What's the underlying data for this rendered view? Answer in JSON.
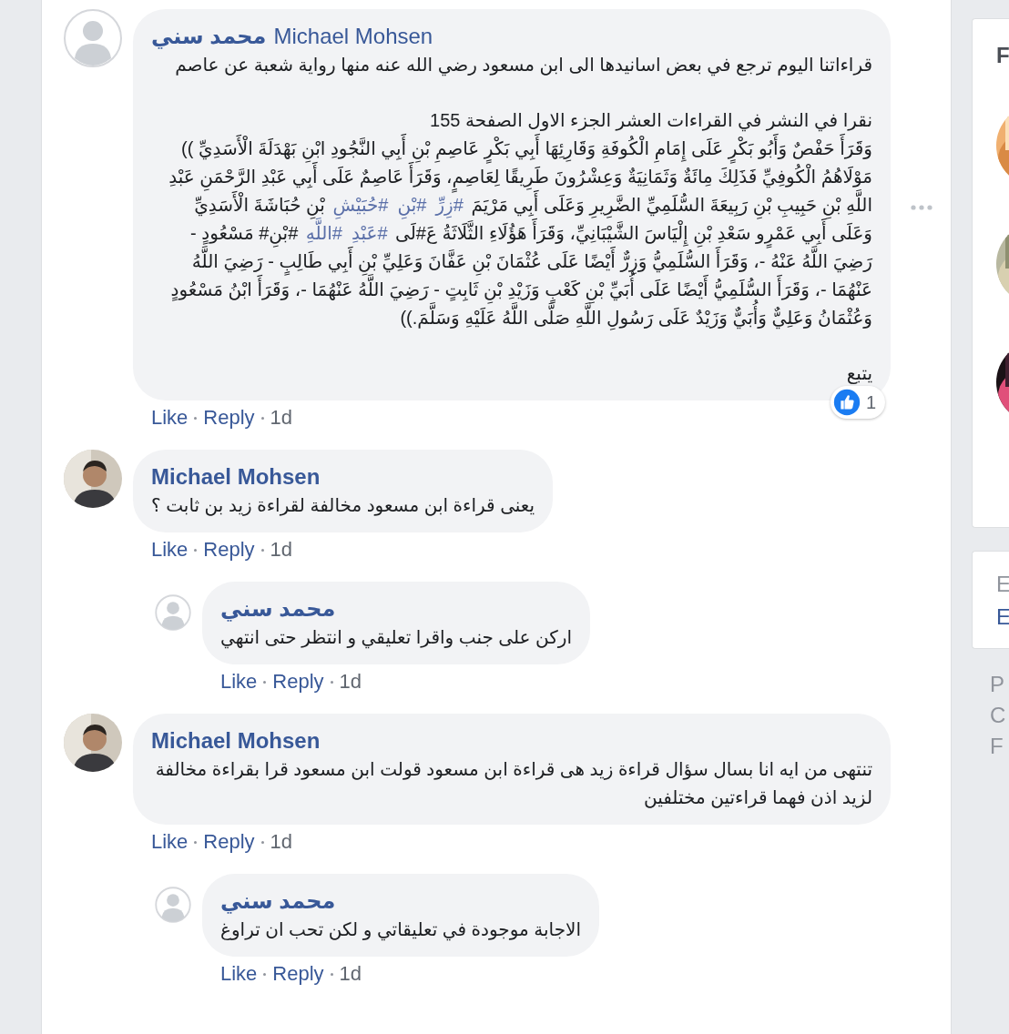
{
  "comments": [
    {
      "author": "محمد سني",
      "mention": "Michael Mohsen",
      "kind": "default",
      "paragraphs": [
        [
          {
            "kind": "text",
            "text": "قراءاتنا اليوم ترجع في بعض اسانيدها الى ابن مسعود رضي الله عنه منها رواية شعبة عن عاصم"
          }
        ],
        [
          {
            "kind": "text",
            "text": "نقرا في النشر في القراءات العشر الجزء الاول الصفحة 155"
          },
          {
            "kind": "break"
          },
          {
            "kind": "text",
            "text": "وَقَرَأَ حَفْصٌ وَأَبُو بَكْرٍ عَلَى إِمَامِ الْكُوفَةِ وَقَارِئِهَا أَبِي بَكْرٍ عَاصِمِ بْنِ أَبِي النَّجُودِ ابْنِ بَهْدَلَةَ الْأَسَدِيِّ )) مَوْلَاهُمُ الْكُوفِيِّ فَذَلِكَ مِائَةٌ وَثَمَانِيَةٌ وَعِشْرُونَ طَرِيقًا لِعَاصِمٍ، وَقَرَأَ عَاصِمٌ عَلَى أَبِي عَبْدِ الرَّحْمَنِ عَبْدِ اللَّهِ بْنِ حَبِيبِ بْنِ رَبِيعَةَ السُّلَمِيِّ الضَّرِيرِ وَعَلَى أَبِي مَرْيَمَ "
          },
          {
            "kind": "hashtag",
            "text": "#زِرِّ"
          },
          {
            "kind": "hashtag",
            "text": "#بْنِ"
          },
          {
            "kind": "hashtag",
            "text": "#حُبَيْشِ"
          },
          {
            "kind": "text",
            "text": " بْنِ حُبَاشَةَ الْأَسَدِيِّ وَعَلَى أَبِي عَمْرٍو سَعْدِ بْنِ إِلْيَاسَ الشَّيْبَانِيِّ، وَقَرَأَ هَؤُلَاءِ الثَّلَاثَةُ عَ#لَى "
          },
          {
            "kind": "hashtag",
            "text": "#عَبْدِ"
          },
          {
            "kind": "hashtag",
            "text": "#اللَّهِ"
          },
          {
            "kind": "text",
            "text": " #بْنِ# مَسْعُودٍ - رَضِيَ اللَّهُ عَنْهُ -، وَقَرَأَ السُّلَمِيُّ وَزِرٌّ أَيْضًا عَلَى عُثْمَانَ بْنِ عَفَّانَ وَعَلِيِّ بْنِ أَبِي طَالِبٍ - رَضِيَ اللَّهُ عَنْهُمَا -، وَقَرَأَ السُّلَمِيُّ أَيْضًا عَلَى أُبَيِّ بْنِ كَعْبٍ وَزَيْدِ بْنِ ثَابِتٍ - رَضِيَ اللَّهُ عَنْهُمَا -، وَقَرَأَ ابْنُ مَسْعُودٍ وَعُثْمَانُ وَعَلِيٌّ وَأُبَيٌّ وَزَيْدٌ عَلَى رَسُولِ اللَّهِ صَلَّى اللَّهُ عَلَيْهِ وَسَلَّمَ.))"
          }
        ],
        [
          {
            "kind": "text",
            "text": "يتبع"
          }
        ]
      ],
      "like": "Like",
      "reply": "Reply",
      "time": "1d",
      "reaction_count": "1"
    },
    {
      "author": "Michael Mohsen",
      "paragraphs": [
        [
          {
            "kind": "text",
            "text": "يعنى قراءة ابن مسعود مخالفة لقراءة زيد بن ثابت ؟"
          }
        ]
      ],
      "like": "Like",
      "reply": "Reply",
      "time": "1d",
      "replies": [
        {
          "author": "محمد سني",
          "kind": "default",
          "paragraphs": [
            [
              {
                "kind": "text",
                "text": "اركن على جنب واقرا تعليقي و انتظر حتى انتهي"
              }
            ]
          ],
          "like": "Like",
          "reply": "Reply",
          "time": "1d"
        }
      ]
    },
    {
      "author": "Michael Mohsen",
      "paragraphs": [
        [
          {
            "kind": "text",
            "text": "تنتهى من ايه انا بسال سؤال قراءة زيد هى قراءة ابن مسعود قولت ابن مسعود قرا بقراءة مخالفة لزيد اذن فهما قراءتين مختلفين"
          }
        ]
      ],
      "like": "Like",
      "reply": "Reply",
      "time": "1d",
      "replies": [
        {
          "author": "محمد سني",
          "kind": "default",
          "paragraphs": [
            [
              {
                "kind": "text",
                "text": "الاجابة موجودة في تعليقاتي و لكن تحب ان تراوغ"
              }
            ]
          ],
          "like": "Like",
          "reply": "Reply",
          "time": "1d"
        }
      ]
    }
  ],
  "sidebar": {
    "cards": [
      {
        "heading": "F"
      },
      {
        "lines": [
          {
            "kind": "label",
            "text": "E"
          },
          {
            "kind": "link",
            "text": "E"
          }
        ]
      }
    ],
    "footer": [
      "P",
      "C",
      "F"
    ]
  }
}
